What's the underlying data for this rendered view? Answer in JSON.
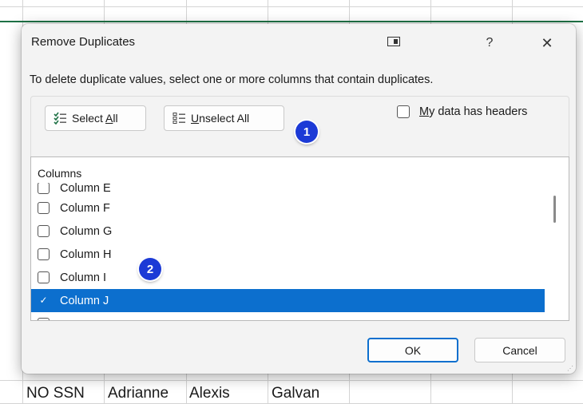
{
  "dialog": {
    "title": "Remove Duplicates",
    "help_glyph": "?",
    "close_glyph": "✕",
    "instruction": "To delete duplicate values, select one or more columns that contain duplicates.",
    "select_all_prefix": "Select ",
    "select_all_accel": "A",
    "select_all_suffix": "ll",
    "unselect_all_accel": "U",
    "unselect_all_suffix": "nselect All",
    "headers_accel": "M",
    "headers_suffix": "y data has headers",
    "headers_checked": false,
    "columns_header": "Columns",
    "columns": [
      {
        "label": "Column E",
        "checked": false
      },
      {
        "label": "Column F",
        "checked": false
      },
      {
        "label": "Column G",
        "checked": false
      },
      {
        "label": "Column H",
        "checked": false
      },
      {
        "label": "Column I",
        "checked": false
      },
      {
        "label": "Column J",
        "checked": true
      }
    ],
    "ok_label": "OK",
    "cancel_label": "Cancel",
    "accent_color": "#0c6fce"
  },
  "annotations": {
    "badge1": "1",
    "badge2": "2",
    "badge_color": "#1c3ad6"
  },
  "sheet": {
    "cells": [
      "NO SSN",
      "Adrianne",
      "Alexis",
      "Galvan"
    ],
    "header_line_color": "#1e7145"
  }
}
